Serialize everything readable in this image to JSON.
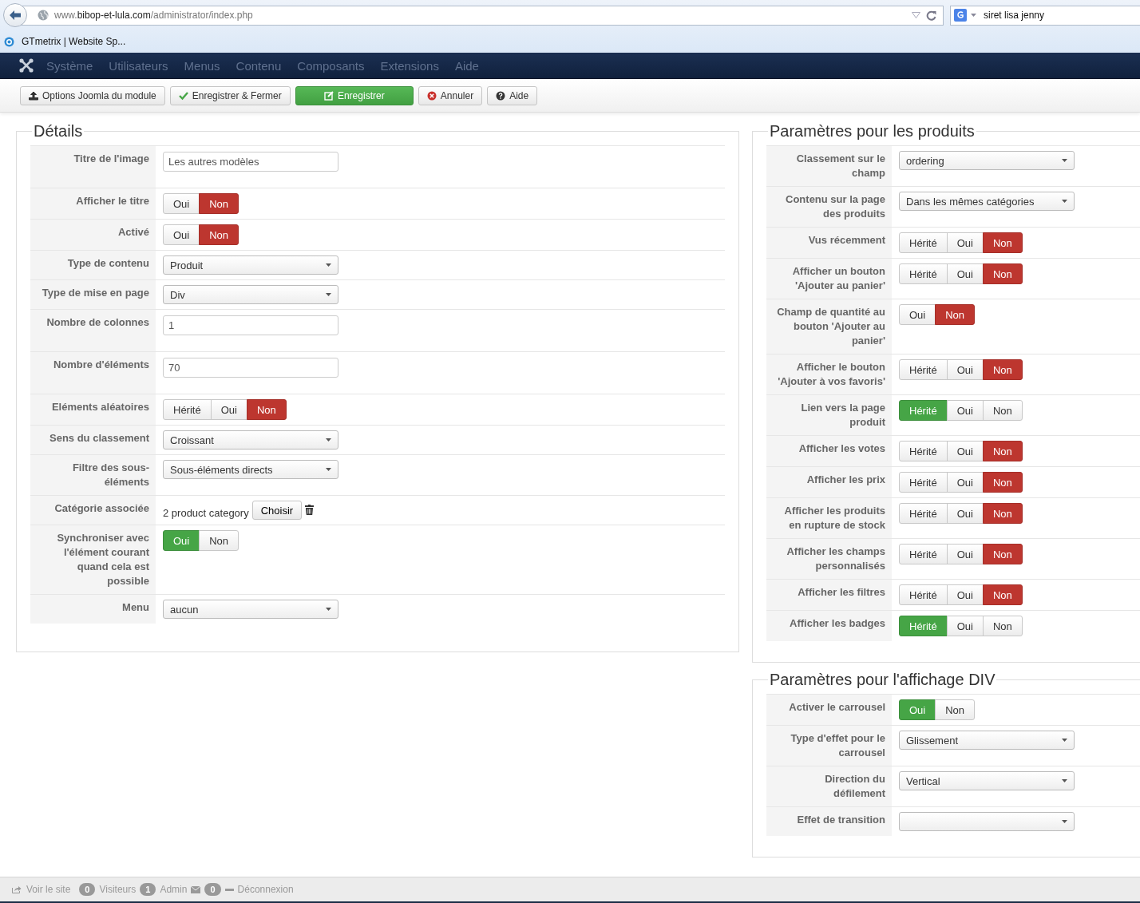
{
  "browser": {
    "url": [
      "www.",
      "bibop-et-lula.com",
      "/administrator/index.php"
    ],
    "search": "siret lisa jenny",
    "bookmarks": [
      "GTmetrix | Website Sp..."
    ]
  },
  "menu": [
    "Système",
    "Utilisateurs",
    "Menus",
    "Contenu",
    "Composants",
    "Extensions",
    "Aide"
  ],
  "toolbar": [
    {
      "label": "Options Joomla du module",
      "kind": "options"
    },
    {
      "label": "Enregistrer & Fermer",
      "kind": "save-close"
    },
    {
      "label": "Enregistrer",
      "kind": "save"
    },
    {
      "label": "Annuler",
      "kind": "cancel"
    },
    {
      "label": "Aide",
      "kind": "help"
    }
  ],
  "left_column": [
    {
      "title": "Détails",
      "rows": [
        {
          "label": "Titre de l'image",
          "control": {
            "kind": "text",
            "value": "Les autres modèles"
          }
        },
        {
          "label": "Afficher le titre",
          "control": {
            "kind": "toggle",
            "options": [
              {
                "label": "Oui",
                "kind": "yes",
                "selected": false
              },
              {
                "label": "Non",
                "kind": "no",
                "selected": true
              }
            ]
          }
        },
        {
          "label": "Activé",
          "control": {
            "kind": "toggle",
            "options": [
              {
                "label": "Oui",
                "kind": "yes",
                "selected": false
              },
              {
                "label": "Non",
                "kind": "no",
                "selected": true
              }
            ]
          }
        },
        {
          "label": "Type de contenu",
          "control": {
            "kind": "select",
            "value": "Produit"
          }
        },
        {
          "label": "Type de mise en page",
          "control": {
            "kind": "select",
            "value": "Div"
          }
        },
        {
          "label": "Nombre de colonnes",
          "control": {
            "kind": "text",
            "value": "1"
          }
        },
        {
          "label": "Nombre d'éléments",
          "control": {
            "kind": "text",
            "value": "70"
          }
        },
        {
          "label": "Eléments aléatoires",
          "control": {
            "kind": "toggle",
            "options": [
              {
                "label": "Hérité",
                "kind": "inherit",
                "selected": false
              },
              {
                "label": "Oui",
                "kind": "yes",
                "selected": false
              },
              {
                "label": "Non",
                "kind": "no",
                "selected": true
              }
            ]
          }
        },
        {
          "label": "Sens du classement",
          "control": {
            "kind": "select",
            "value": "Croissant"
          }
        },
        {
          "label": "Filtre des sous-éléments",
          "control": {
            "kind": "select",
            "value": "Sous-éléments directs"
          }
        },
        {
          "label": "Catégorie associée",
          "control": {
            "kind": "category",
            "value": "2 product category",
            "button": "Choisir"
          }
        },
        {
          "label": "Synchroniser avec l'élément courant quand cela est possible",
          "control": {
            "kind": "toggle",
            "options": [
              {
                "label": "Oui",
                "kind": "yes",
                "selected": true
              },
              {
                "label": "Non",
                "kind": "no",
                "selected": false
              }
            ]
          }
        },
        {
          "label": "Menu",
          "control": {
            "kind": "select",
            "value": "aucun"
          }
        }
      ]
    }
  ],
  "right_column": [
    {
      "title": "Paramètres pour les produits",
      "rows": [
        {
          "label": "Classement sur le champ",
          "control": {
            "kind": "select",
            "value": "ordering"
          }
        },
        {
          "label": "Contenu sur la page des produits",
          "control": {
            "kind": "select",
            "value": "Dans les mêmes catégories"
          }
        },
        {
          "label": "Vus récemment",
          "control": {
            "kind": "toggle",
            "options": [
              {
                "label": "Hérité",
                "kind": "inherit",
                "selected": false
              },
              {
                "label": "Oui",
                "kind": "yes",
                "selected": false
              },
              {
                "label": "Non",
                "kind": "no",
                "selected": true
              }
            ]
          }
        },
        {
          "label": "Afficher un bouton 'Ajouter au panier'",
          "control": {
            "kind": "toggle",
            "options": [
              {
                "label": "Hérité",
                "kind": "inherit",
                "selected": false
              },
              {
                "label": "Oui",
                "kind": "yes",
                "selected": false
              },
              {
                "label": "Non",
                "kind": "no",
                "selected": true
              }
            ]
          }
        },
        {
          "label": "Champ de quantité au bouton 'Ajouter au panier'",
          "control": {
            "kind": "toggle",
            "options": [
              {
                "label": "Oui",
                "kind": "yes",
                "selected": false
              },
              {
                "label": "Non",
                "kind": "no",
                "selected": true
              }
            ]
          }
        },
        {
          "label": "Afficher le bouton 'Ajouter à vos favoris'",
          "control": {
            "kind": "toggle",
            "options": [
              {
                "label": "Hérité",
                "kind": "inherit",
                "selected": false
              },
              {
                "label": "Oui",
                "kind": "yes",
                "selected": false
              },
              {
                "label": "Non",
                "kind": "no",
                "selected": true
              }
            ]
          }
        },
        {
          "label": "Lien vers la page produit",
          "control": {
            "kind": "toggle",
            "options": [
              {
                "label": "Hérité",
                "kind": "inherit",
                "selected": true
              },
              {
                "label": "Oui",
                "kind": "yes",
                "selected": false
              },
              {
                "label": "Non",
                "kind": "no",
                "selected": false
              }
            ]
          }
        },
        {
          "label": "Afficher les votes",
          "control": {
            "kind": "toggle",
            "options": [
              {
                "label": "Hérité",
                "kind": "inherit",
                "selected": false
              },
              {
                "label": "Oui",
                "kind": "yes",
                "selected": false
              },
              {
                "label": "Non",
                "kind": "no",
                "selected": true
              }
            ]
          }
        },
        {
          "label": "Afficher les prix",
          "control": {
            "kind": "toggle",
            "options": [
              {
                "label": "Hérité",
                "kind": "inherit",
                "selected": false
              },
              {
                "label": "Oui",
                "kind": "yes",
                "selected": false
              },
              {
                "label": "Non",
                "kind": "no",
                "selected": true
              }
            ]
          }
        },
        {
          "label": "Afficher les produits en rupture de stock",
          "control": {
            "kind": "toggle",
            "options": [
              {
                "label": "Hérité",
                "kind": "inherit",
                "selected": false
              },
              {
                "label": "Oui",
                "kind": "yes",
                "selected": false
              },
              {
                "label": "Non",
                "kind": "no",
                "selected": true
              }
            ]
          }
        },
        {
          "label": "Afficher les champs personnalisés",
          "control": {
            "kind": "toggle",
            "options": [
              {
                "label": "Hérité",
                "kind": "inherit",
                "selected": false
              },
              {
                "label": "Oui",
                "kind": "yes",
                "selected": false
              },
              {
                "label": "Non",
                "kind": "no",
                "selected": true
              }
            ]
          }
        },
        {
          "label": "Afficher les filtres",
          "control": {
            "kind": "toggle",
            "options": [
              {
                "label": "Hérité",
                "kind": "inherit",
                "selected": false
              },
              {
                "label": "Oui",
                "kind": "yes",
                "selected": false
              },
              {
                "label": "Non",
                "kind": "no",
                "selected": true
              }
            ]
          }
        },
        {
          "label": "Afficher les badges",
          "control": {
            "kind": "toggle",
            "options": [
              {
                "label": "Hérité",
                "kind": "inherit",
                "selected": true
              },
              {
                "label": "Oui",
                "kind": "yes",
                "selected": false
              },
              {
                "label": "Non",
                "kind": "no",
                "selected": false
              }
            ]
          }
        }
      ]
    },
    {
      "title": "Paramètres pour l'affichage DIV",
      "rows": [
        {
          "label": "Activer le carrousel",
          "control": {
            "kind": "toggle",
            "options": [
              {
                "label": "Oui",
                "kind": "yes",
                "selected": true
              },
              {
                "label": "Non",
                "kind": "no",
                "selected": false
              }
            ]
          }
        },
        {
          "label": "Type d'effet pour le carrousel",
          "control": {
            "kind": "select",
            "value": "Glissement"
          }
        },
        {
          "label": "Direction du défilement",
          "control": {
            "kind": "select",
            "value": "Vertical"
          }
        },
        {
          "label": "Effet de transition",
          "control": {
            "kind": "select"
          }
        }
      ]
    }
  ],
  "status_bar": [
    {
      "kind": "link",
      "label": "Voir le site"
    },
    {
      "kind": "count",
      "count": "0",
      "label": "Visiteurs"
    },
    {
      "kind": "count",
      "count": "1",
      "label": "Admin"
    },
    {
      "kind": "messages",
      "count": "0"
    },
    {
      "kind": "logout",
      "label": "Déconnexion"
    }
  ]
}
